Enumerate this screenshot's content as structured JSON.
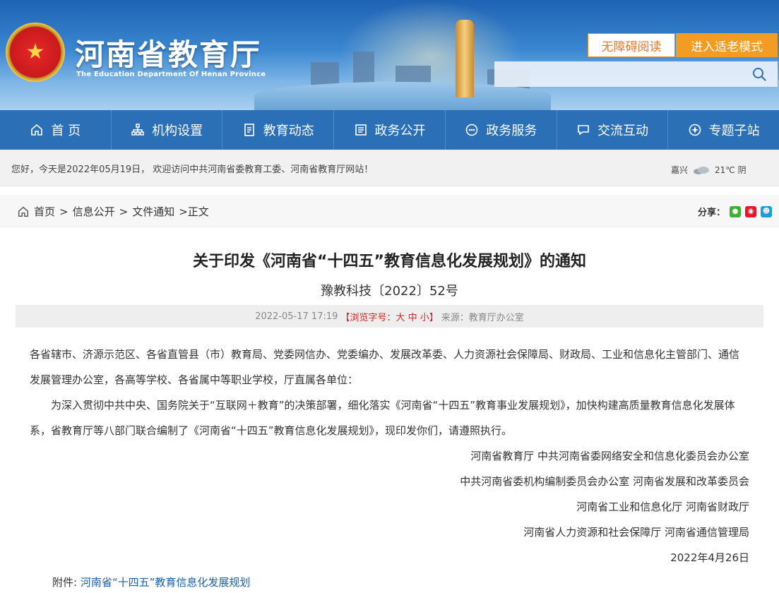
{
  "header": {
    "title": "河南省教育厅",
    "subtitle": "The Education Department Of Henan Province",
    "accessibility_button": "无障碍阅读",
    "elder_mode_button": "进入适老模式",
    "search_placeholder": ""
  },
  "nav": {
    "items": [
      {
        "label": "首 页",
        "icon": "home-icon"
      },
      {
        "label": "机构设置",
        "icon": "org-icon"
      },
      {
        "label": "教育动态",
        "icon": "news-icon"
      },
      {
        "label": "政务公开",
        "icon": "doc-icon"
      },
      {
        "label": "政务服务",
        "icon": "service-icon"
      },
      {
        "label": "交流互动",
        "icon": "chat-icon"
      },
      {
        "label": "专题子站",
        "icon": "topic-icon"
      }
    ]
  },
  "welcome": {
    "text": "您好，今天是2022年05月19日， 欢迎访问中共河南省委教育工委、河南省教育厅网站！",
    "city": "嘉兴",
    "weather": "21℃ 阴"
  },
  "breadcrumb": {
    "items": [
      "首页",
      "信息公开",
      "文件通知"
    ],
    "current": "正文",
    "separator": ">"
  },
  "share": {
    "label": "分享：",
    "icons": [
      "wechat-icon",
      "weibo-icon",
      "qq-icon"
    ]
  },
  "article": {
    "title": "关于印发《河南省“十四五”教育信息化发展规划》的通知",
    "doc_number": "豫教科技〔2022〕52号",
    "datetime": "2022-05-17 17:19",
    "font_size_label": "【浏览字号：",
    "font_size_large": "大",
    "font_size_medium": "中",
    "font_size_small": "小",
    "font_size_close": "】",
    "source": "来源：教育厅办公室",
    "recipients": "各省辖市、济源示范区、各省直管县（市）教育局、党委网信办、党委编办、发展改革委、人力资源社会保障局、财政局、工业和信息化主管部门、通信发展管理办公室，各高等学校、各省属中等职业学校，厅直属各单位：",
    "body": "为深入贯彻中共中央、国务院关于“互联网＋教育”的决策部署，细化落实《河南省“十四五”教育事业发展规划》，加快构建高质量教育信息化发展体系，省教育厅等八部门联合编制了《河南省“十四五”教育信息化发展规划》，现印发你们，请遵照执行。",
    "signatories": [
      "河南省教育厅 中共河南省委网络安全和信息化委员会办公室",
      "中共河南省委机构编制委员会办公室 河南省发展和改革委员会",
      "河南省工业和信息化厅 河南省财政厅",
      "河南省人力资源和社会保障厅 河南省通信管理局"
    ],
    "date": "2022年4月26日",
    "attachment_label": "附件:",
    "attachment_link": "河南省“十四五”教育信息化发展规划"
  },
  "colors": {
    "nav_bg": "#2b6fb6",
    "accent_orange": "#f39c24",
    "link_blue": "#1a5fb4",
    "meta_red": "#d62a2a"
  }
}
